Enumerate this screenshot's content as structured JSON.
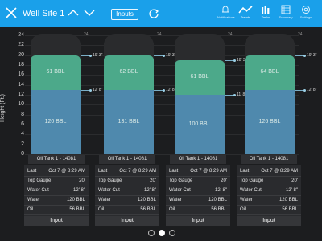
{
  "header": {
    "title": "Well Site 1",
    "inputs_label": "Inputs",
    "nav": [
      {
        "label": "Notifications",
        "icon": "bell-icon"
      },
      {
        "label": "Trends",
        "icon": "trend-icon"
      },
      {
        "label": "Tanks",
        "icon": "tanks-icon"
      },
      {
        "label": "Summary",
        "icon": "summary-icon"
      },
      {
        "label": "Settings",
        "icon": "gear-icon"
      }
    ]
  },
  "chart": {
    "y_label": "Height (Ft.)",
    "y_ticks": [
      "24",
      "22",
      "20",
      "18",
      "16",
      "14",
      "12",
      "10",
      "8",
      "6",
      "4",
      "2",
      "0"
    ],
    "tanks": [
      {
        "top_label": "24",
        "oil_label": "61 BBL",
        "water_label": "120 BBL",
        "gauge_label": "19' 3\"",
        "cut_label": "12' 8\"",
        "oil_height": 7,
        "water_height": 13
      },
      {
        "top_label": "24",
        "oil_label": "62 BBL",
        "water_label": "131 BBL",
        "gauge_label": "19' 3\"",
        "cut_label": "12' 8\"",
        "oil_height": 7,
        "water_height": 13
      },
      {
        "top_label": "24",
        "oil_label": "61 BBL",
        "water_label": "100 BBL",
        "gauge_label": "18' 3\"",
        "cut_label": "11' 8\"",
        "oil_height": 7,
        "water_height": 12
      },
      {
        "top_label": "24",
        "oil_label": "64 BBL",
        "water_label": "126 BBL",
        "gauge_label": "19' 3\"",
        "cut_label": "12' 8\"",
        "oil_height": 7,
        "water_height": 13
      }
    ]
  },
  "tanks": [
    {
      "name": "Oil Tank 1 - 14081",
      "last_label": "Last",
      "last_value": "Oct 7 @ 8:29 AM",
      "top_gauge_label": "Top Gauge",
      "top_gauge_value": "20'",
      "water_cut_label": "Water Cut",
      "water_cut_value": "12' 8\"",
      "water_label": "Water",
      "water_value": "120 BBL",
      "oil_label": "Oil",
      "oil_value": "56 BBL",
      "button": "Input"
    },
    {
      "name": "Oil Tank 1 - 14081",
      "last_label": "Last",
      "last_value": "Oct 7 @ 8:29 AM",
      "top_gauge_label": "Top Gauge",
      "top_gauge_value": "20'",
      "water_cut_label": "Water Cut",
      "water_cut_value": "12' 8\"",
      "water_label": "Water",
      "water_value": "120 BBL",
      "oil_label": "Oil",
      "oil_value": "56 BBL",
      "button": "Input"
    },
    {
      "name": "Oil Tank 1 - 14081",
      "last_label": "Last",
      "last_value": "Oct 7 @ 8:29 AM",
      "top_gauge_label": "Top Gauge",
      "top_gauge_value": "20'",
      "water_cut_label": "Water Cut",
      "water_cut_value": "12' 8\"",
      "water_label": "Water",
      "water_value": "120 BBL",
      "oil_label": "Oil",
      "oil_value": "56 BBL",
      "button": "Input"
    },
    {
      "name": "Oil Tank 1 - 14081",
      "last_label": "Last",
      "last_value": "Oct 7 @ 8:29 AM",
      "top_gauge_label": "Top Gauge",
      "top_gauge_value": "20'",
      "water_cut_label": "Water Cut",
      "water_cut_value": "12' 8\"",
      "water_label": "Water",
      "water_value": "120 BBL",
      "oil_label": "Oil",
      "oil_value": "56 BBL",
      "button": "Input"
    }
  ],
  "pager": {
    "pages": 3,
    "current": 2
  },
  "colors": {
    "header": "#1aa0ea",
    "oil": "#4ca98a",
    "water": "#4f89ad",
    "background": "#1c1d1f"
  }
}
